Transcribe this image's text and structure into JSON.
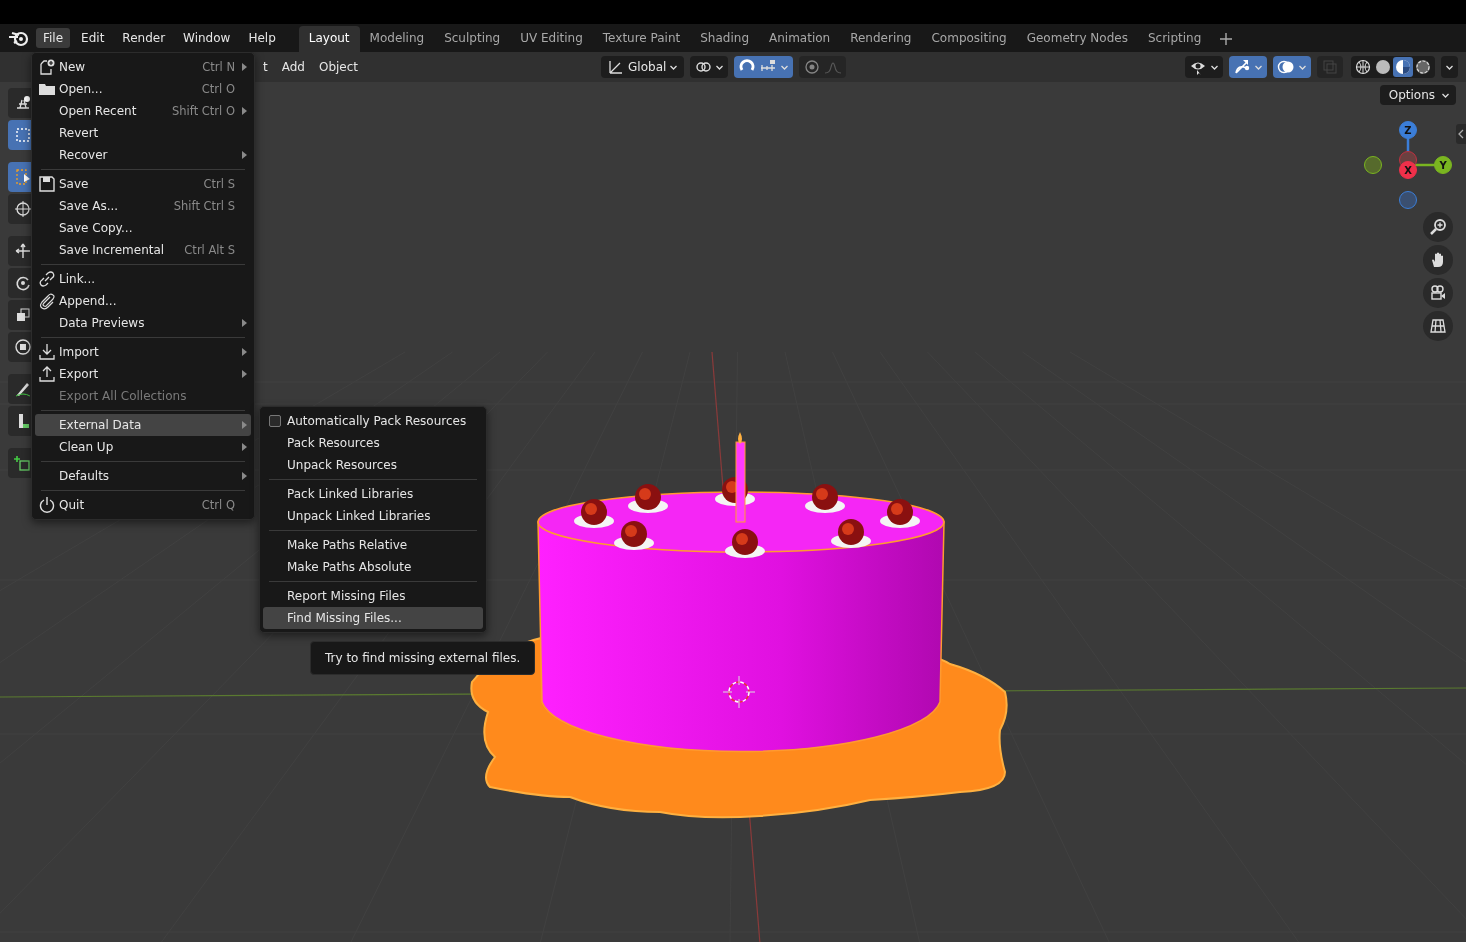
{
  "menubar": {
    "menus": [
      {
        "label": "File",
        "selected": true
      },
      {
        "label": "Edit",
        "selected": false
      },
      {
        "label": "Render",
        "selected": false
      },
      {
        "label": "Window",
        "selected": false
      },
      {
        "label": "Help",
        "selected": false
      }
    ]
  },
  "workspaces": [
    {
      "label": "Layout",
      "selected": true
    },
    {
      "label": "Modeling",
      "selected": false
    },
    {
      "label": "Sculpting",
      "selected": false
    },
    {
      "label": "UV Editing",
      "selected": false
    },
    {
      "label": "Texture Paint",
      "selected": false
    },
    {
      "label": "Shading",
      "selected": false
    },
    {
      "label": "Animation",
      "selected": false
    },
    {
      "label": "Rendering",
      "selected": false
    },
    {
      "label": "Compositing",
      "selected": false
    },
    {
      "label": "Geometry Nodes",
      "selected": false
    },
    {
      "label": "Scripting",
      "selected": false
    }
  ],
  "header": {
    "menus": [
      "t",
      "Add",
      "Object"
    ],
    "orientation": "Global",
    "snapping_on": true,
    "proportional_on": false,
    "gizmos_on": true,
    "overlays_on": true,
    "xray_on": false,
    "shading_modes": [
      {
        "selected": false
      },
      {
        "selected": false
      },
      {
        "selected": true
      },
      {
        "selected": false
      }
    ]
  },
  "options": "Options",
  "axes": {
    "z": "Z",
    "x": "X",
    "y": "Y"
  },
  "file_menu": [
    [
      {
        "label": "New",
        "shortcut": "Ctrl N",
        "kind": "new",
        "submenu": true,
        "disabled": false,
        "selected": false
      },
      {
        "label": "Open...",
        "shortcut": "Ctrl O",
        "kind": "open",
        "submenu": false,
        "disabled": false,
        "selected": false
      },
      {
        "label": "Open Recent",
        "shortcut": "Shift Ctrl O",
        "kind": "text",
        "submenu": true,
        "disabled": false,
        "selected": false
      },
      {
        "label": "Revert",
        "kind": "text",
        "submenu": false,
        "disabled": false,
        "selected": false
      },
      {
        "label": "Recover",
        "kind": "text",
        "submenu": true,
        "disabled": false,
        "selected": false
      }
    ],
    [
      {
        "label": "Save",
        "shortcut": "Ctrl S",
        "kind": "save",
        "submenu": false,
        "disabled": false,
        "selected": false
      },
      {
        "label": "Save As...",
        "shortcut": "Shift Ctrl S",
        "kind": "text",
        "submenu": false,
        "disabled": false,
        "selected": false
      },
      {
        "label": "Save Copy...",
        "kind": "text",
        "submenu": false,
        "disabled": false,
        "selected": false
      },
      {
        "label": "Save Incremental",
        "shortcut": "Ctrl Alt S",
        "kind": "text",
        "submenu": false,
        "disabled": false,
        "selected": false
      }
    ],
    [
      {
        "label": "Link...",
        "kind": "link",
        "submenu": false,
        "disabled": false,
        "selected": false
      },
      {
        "label": "Append...",
        "kind": "append",
        "submenu": false,
        "disabled": false,
        "selected": false
      },
      {
        "label": "Data Previews",
        "kind": "text",
        "submenu": true,
        "disabled": false,
        "selected": false
      }
    ],
    [
      {
        "label": "Import",
        "kind": "import",
        "submenu": true,
        "disabled": false,
        "selected": false
      },
      {
        "label": "Export",
        "kind": "export",
        "submenu": true,
        "disabled": false,
        "selected": false
      },
      {
        "label": "Export All Collections",
        "kind": "text",
        "submenu": false,
        "disabled": true,
        "selected": false
      }
    ],
    [
      {
        "label": "External Data",
        "kind": "text",
        "submenu": true,
        "disabled": false,
        "selected": true
      },
      {
        "label": "Clean Up",
        "kind": "text",
        "submenu": true,
        "disabled": false,
        "selected": false
      }
    ],
    [
      {
        "label": "Defaults",
        "kind": "text",
        "submenu": true,
        "disabled": false,
        "selected": false
      }
    ],
    [
      {
        "label": "Quit",
        "shortcut": "Ctrl Q",
        "kind": "quit",
        "submenu": false,
        "disabled": false,
        "selected": false
      }
    ]
  ],
  "external_data_menu": [
    [
      {
        "label": "Automatically Pack Resources",
        "kind": "checkbox",
        "checked": false,
        "selected": false
      },
      {
        "label": "Pack Resources",
        "kind": "text",
        "selected": false
      },
      {
        "label": "Unpack Resources",
        "kind": "text",
        "selected": false
      }
    ],
    [
      {
        "label": "Pack Linked Libraries",
        "kind": "text",
        "selected": false
      },
      {
        "label": "Unpack Linked Libraries",
        "kind": "text",
        "selected": false
      }
    ],
    [
      {
        "label": "Make Paths Relative",
        "kind": "text",
        "selected": false
      },
      {
        "label": "Make Paths Absolute",
        "kind": "text",
        "selected": false
      }
    ],
    [
      {
        "label": "Report Missing Files",
        "kind": "text",
        "selected": false
      },
      {
        "label": "Find Missing Files...",
        "kind": "text",
        "selected": true
      }
    ]
  ],
  "tooltip": "Try to find missing external files."
}
